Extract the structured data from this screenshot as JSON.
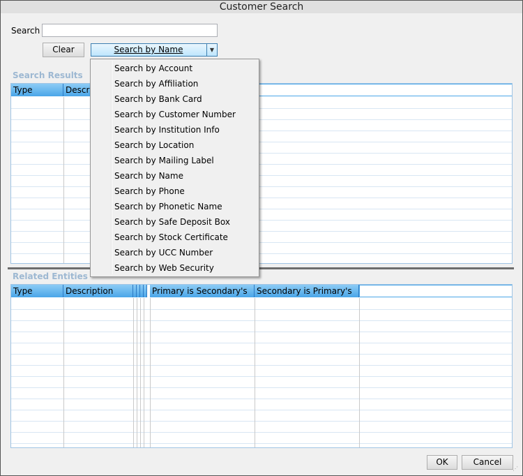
{
  "window": {
    "title": "Customer Search"
  },
  "search": {
    "label": "Search",
    "value": ""
  },
  "buttons": {
    "clear": "Clear",
    "ok": "OK",
    "cancel": "Cancel"
  },
  "search_mode": {
    "selected": "Search by Name",
    "options": [
      "Search by Account",
      "Search by Affiliation",
      "Search by Bank Card",
      "Search by Customer Number",
      "Search by Institution Info",
      "Search by Location",
      "Search by Mailing Label",
      "Search by Name",
      "Search by Phone",
      "Search by Phonetic Name",
      "Search by Safe Deposit Box",
      "Search by Stock Certificate",
      "Search by UCC Number",
      "Search by Web Security"
    ]
  },
  "search_results": {
    "title": "Search Results",
    "columns": [
      "Type",
      "Descrip"
    ]
  },
  "related_entities": {
    "title": "Related Entities",
    "columns": [
      "Type",
      "Description",
      "",
      "",
      "",
      "Primary is Secondary's",
      "Secondary is Primary's",
      ""
    ]
  }
}
